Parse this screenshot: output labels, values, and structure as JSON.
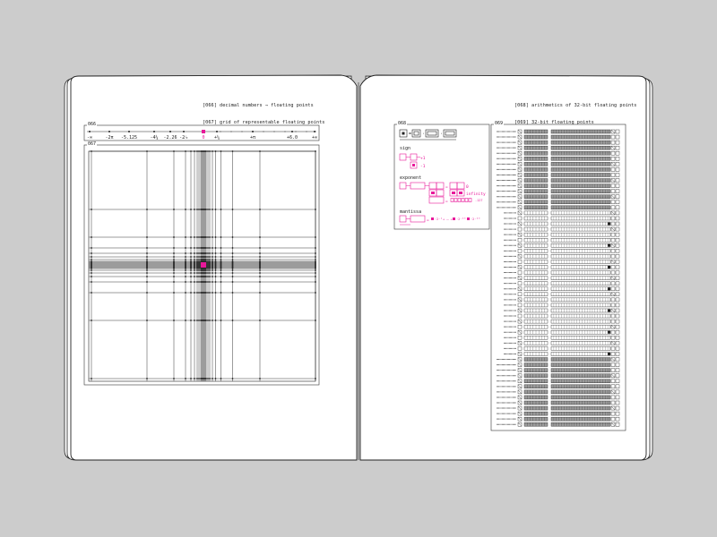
{
  "left_page": {
    "header_lines": [
      "[066] decimal numbers → floating points",
      "[067] grid of representable floating points"
    ],
    "figure_066_tag": "066",
    "figure_067_tag": "067",
    "number_line_labels": [
      {
        "text": "-∞"
      },
      {
        "text": "-2π"
      },
      {
        "text": "-5.125"
      },
      {
        "text": "-4¼"
      },
      {
        "text": "-2.26"
      },
      {
        "text": "-2⁄₃"
      },
      {
        "text": "0",
        "accent": true
      },
      {
        "text": "+¼"
      },
      {
        "text": "+π"
      },
      {
        "text": "+6.0"
      },
      {
        "text": "+∞"
      }
    ]
  },
  "right_page": {
    "header_lines": [
      "[068] arithmetics of 32-bit floating points",
      "[069] 32-bit floating points"
    ],
    "figure_068_tag": "068",
    "figure_069_tag": "069",
    "legend": {
      "sign_title": "sign",
      "sign_pos": "+1",
      "sign_neg": "-1",
      "exponent_title": "exponent",
      "exponent_zero": "0",
      "exponent_inf": "infinity",
      "mantissa_title": "mantissa"
    }
  },
  "colors": {
    "background": "#cccccc",
    "page": "#ffffff",
    "ink": "#222222",
    "accent": "#e8189a"
  }
}
